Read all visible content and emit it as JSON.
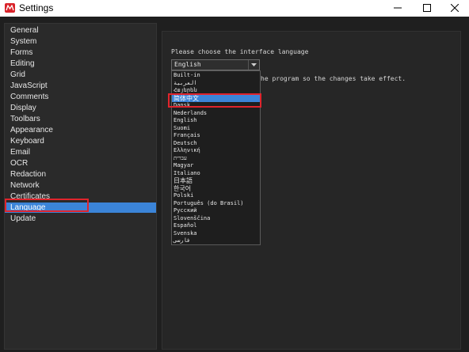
{
  "window": {
    "title": "Settings",
    "controls": [
      "minimize",
      "maximize",
      "close"
    ]
  },
  "sidebar": {
    "items": [
      {
        "label": "General"
      },
      {
        "label": "System"
      },
      {
        "label": "Forms"
      },
      {
        "label": "Editing"
      },
      {
        "label": "Grid"
      },
      {
        "label": "JavaScript"
      },
      {
        "label": "Comments"
      },
      {
        "label": "Display"
      },
      {
        "label": "Toolbars"
      },
      {
        "label": "Appearance"
      },
      {
        "label": "Keyboard"
      },
      {
        "label": "Email"
      },
      {
        "label": "OCR"
      },
      {
        "label": "Redaction"
      },
      {
        "label": "Network"
      },
      {
        "label": "Certificates"
      },
      {
        "label": "Language",
        "selected": true
      },
      {
        "label": "Update"
      }
    ]
  },
  "language": {
    "prompt": "Please choose the interface language",
    "restart_note": "he program so the changes take effect.",
    "select_value": "English",
    "options": [
      "Built-in",
      "العربية",
      "Հայերեն",
      "简体中文",
      "Dansk",
      "Nederlands",
      "English",
      "Suomi",
      "Français",
      "Deutsch",
      "Ελληνική",
      "עברית",
      "Magyar",
      "Italiano",
      "日本語",
      "한국어",
      "Polski",
      "Português (do Brasil)",
      "Русский",
      "Slovenščina",
      "Español",
      "Svenska",
      "فارسی"
    ],
    "highlighted_option": "简体中文"
  },
  "colors": {
    "accent": "#3b84d8",
    "annotation": "#e0242c",
    "background": "#1f1f1f",
    "panel": "#2a2a2a"
  }
}
